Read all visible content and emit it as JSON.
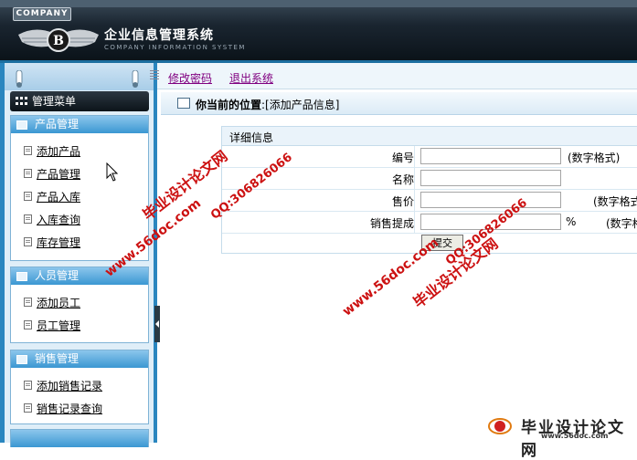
{
  "header": {
    "company_badge": "COMPANY",
    "title": "企业信息管理系统",
    "subtitle": "COMPANY INFORMATION SYSTEM"
  },
  "topnav": {
    "change_password": "修改密码",
    "logout": "退出系统"
  },
  "sidebar": {
    "menu_title": "管理菜单",
    "groups": [
      {
        "title": "产品管理",
        "items": [
          "添加产品",
          "产品管理",
          "产品入库",
          "入库查询",
          "库存管理"
        ]
      },
      {
        "title": "人员管理",
        "items": [
          "添加员工",
          "员工管理"
        ]
      },
      {
        "title": "销售管理",
        "items": [
          "添加销售记录",
          "销售记录查询"
        ]
      }
    ]
  },
  "location": {
    "label": "你当前的位置",
    "value": ":[添加产品信息]"
  },
  "form": {
    "header": "详细信息",
    "rows": [
      {
        "label": "编号",
        "hint": "(数字格式)"
      },
      {
        "label": "名称",
        "hint": ""
      },
      {
        "label": "售价",
        "hint": "(数字格式)"
      },
      {
        "label": "销售提成",
        "unit": "%",
        "hint": "(数字格式)"
      }
    ],
    "submit": "提交"
  },
  "watermarks": {
    "site_cn": "毕业设计论文网",
    "site_url": "www.56doc.com",
    "qq": "QQ:306826066"
  },
  "corner_logo": {
    "title": "毕业设计论文网",
    "url": "www.56doc.com"
  },
  "colors": {
    "header_dark": "#0a1218",
    "sidebar_blue": "#2a86bf",
    "group_head": "#3b97d2",
    "link_visited": "#800080",
    "watermark_red": "#cc1111"
  }
}
